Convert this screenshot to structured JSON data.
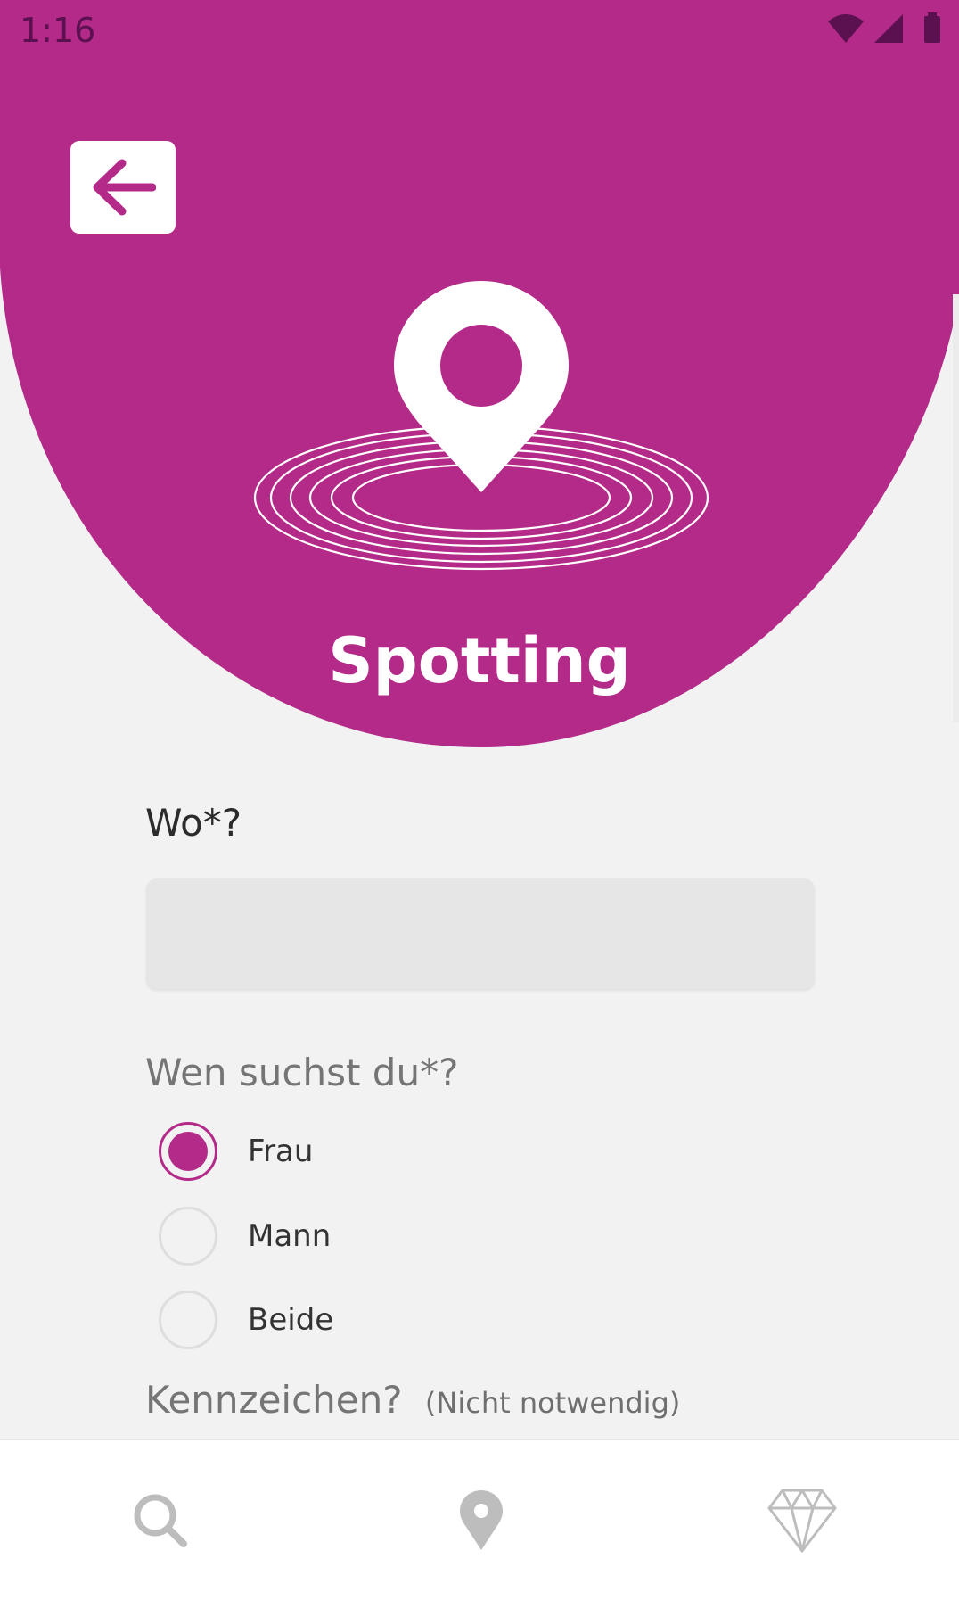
{
  "status_bar": {
    "time": "1:16",
    "icons": [
      "wifi-icon",
      "signal-icon",
      "battery-icon"
    ]
  },
  "header": {
    "back_icon": "arrow-left-icon",
    "illustration_icon": "location-pin-icon",
    "title": "Spotting"
  },
  "form": {
    "where_label": "Wo*?",
    "where_value": "",
    "who_label": "Wen suchst du*?",
    "gender_options": [
      {
        "label": "Frau",
        "selected": true
      },
      {
        "label": "Mann",
        "selected": false
      },
      {
        "label": "Beide",
        "selected": false
      }
    ],
    "marker_label": "Kennzeichen?",
    "marker_note": "(Nicht notwendig)"
  },
  "bottom_nav": {
    "items": [
      {
        "icon": "search-icon"
      },
      {
        "icon": "location-pin-icon"
      },
      {
        "icon": "diamond-icon"
      }
    ]
  },
  "colors": {
    "primary": "#b42a89",
    "background": "#f2f2f2",
    "input_background": "#e6e6e6",
    "nav_icon": "#bdbdbd"
  }
}
